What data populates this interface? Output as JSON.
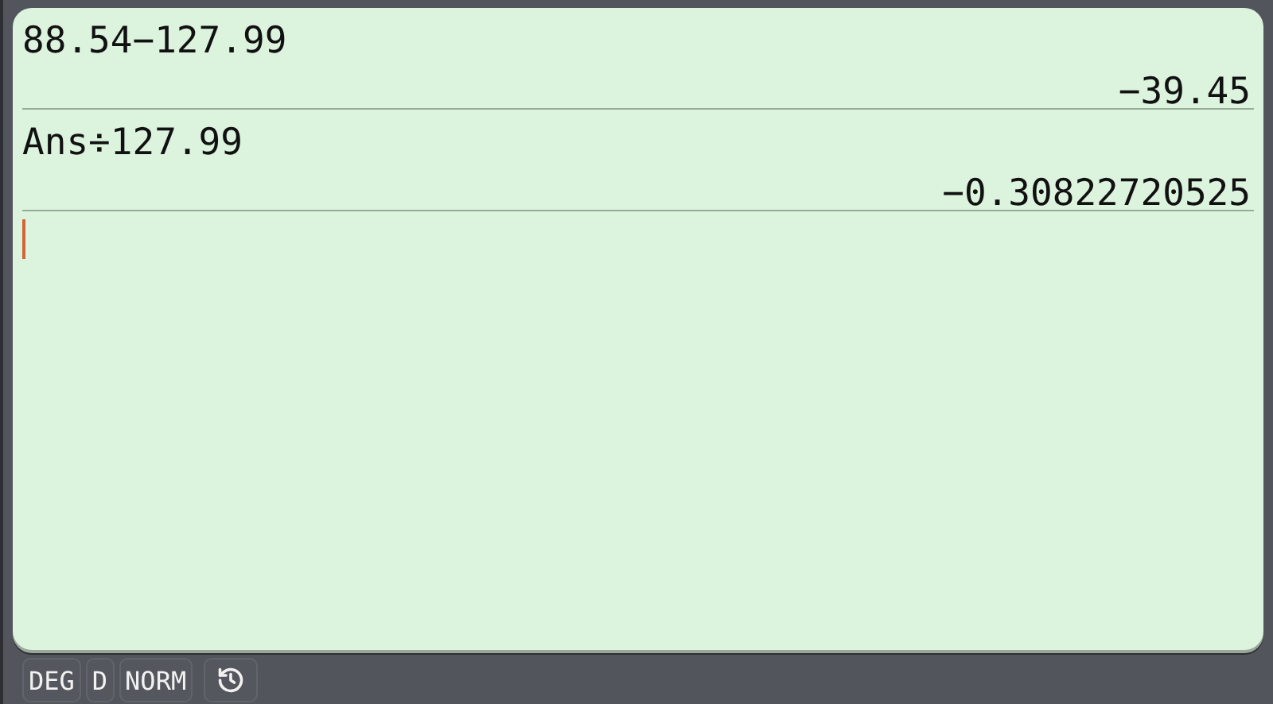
{
  "history": [
    {
      "expression": "88.54−127.99",
      "result": "−39.45"
    },
    {
      "expression": "Ans÷127.99",
      "result": "−0.30822720525"
    }
  ],
  "input": {
    "cursor": true
  },
  "status_bar": {
    "buttons": [
      {
        "kind": "text",
        "label": "DEG"
      },
      {
        "kind": "text",
        "label": "D"
      },
      {
        "kind": "text",
        "label": "NORM"
      },
      {
        "kind": "history"
      }
    ]
  }
}
